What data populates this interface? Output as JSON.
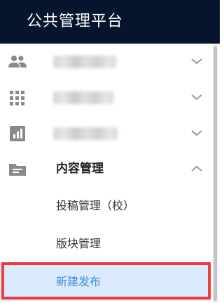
{
  "header": {
    "title": "公共管理平台"
  },
  "menu": {
    "items": [
      {
        "icon": "people-icon",
        "label": "",
        "blurred": true,
        "expanded": false
      },
      {
        "icon": "apps-grid-icon",
        "label": "",
        "blurred": true,
        "expanded": false
      },
      {
        "icon": "chart-icon",
        "label": "",
        "blurred": true,
        "expanded": false
      },
      {
        "icon": "folder-icon",
        "label": "内容管理",
        "blurred": false,
        "expanded": true
      }
    ],
    "submenu": [
      {
        "label": "投稿管理（校）",
        "active": false
      },
      {
        "label": "版块管理",
        "active": false
      },
      {
        "label": "新建发布",
        "active": true
      }
    ]
  },
  "colors": {
    "header_bg": "#07142e",
    "header_text": "#ffffff",
    "icon_gray": "#8a8a8a",
    "active_text": "#3d8fe0",
    "active_bg": "#dbeafd",
    "highlight_border": "#ef3a3a"
  }
}
